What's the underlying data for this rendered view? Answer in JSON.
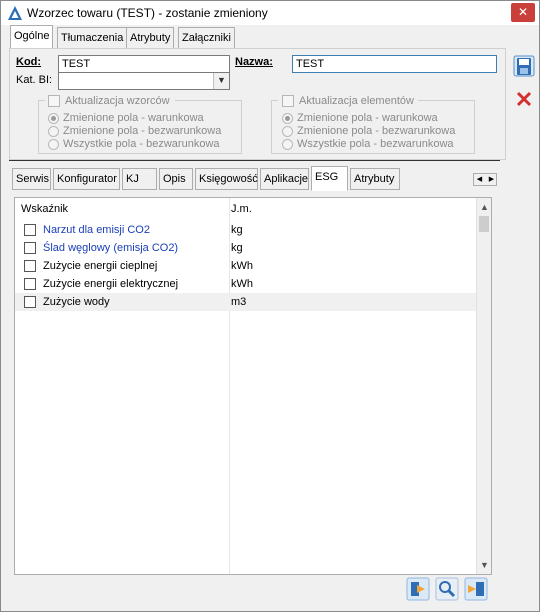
{
  "window": {
    "title": "Wzorzec towaru (TEST) - zostanie zmieniony"
  },
  "tabs_top": [
    "Ogólne",
    "Tłumaczenia",
    "Atrybuty",
    "Załączniki"
  ],
  "form": {
    "kod_label": "Kod:",
    "kod_value": "TEST",
    "nazwa_label": "Nazwa:",
    "nazwa_value": "TEST",
    "katbi_label": "Kat. BI:",
    "katbi_value": ""
  },
  "group_wzorcow": {
    "title": "Aktualizacja wzorców",
    "options": [
      "Zmienione pola - warunkowa",
      "Zmienione pola - bezwarunkowa",
      "Wszystkie pola - bezwarunkowa"
    ]
  },
  "group_elementow": {
    "title": "Aktualizacja elementów",
    "options": [
      "Zmienione pola - warunkowa",
      "Zmienione pola - bezwarunkowa",
      "Wszystkie pola - bezwarunkowa"
    ]
  },
  "tabs_bottom": [
    "Serwis",
    "Konfigurator",
    "KJ",
    "Opis",
    "Księgowość",
    "Aplikacje",
    "ESG",
    "Atrybuty"
  ],
  "grid": {
    "headers": [
      "Wskaźnik",
      "J.m."
    ],
    "rows": [
      {
        "name": "Narzut dla emisji CO2",
        "unit": "kg"
      },
      {
        "name": "Ślad węglowy (emisja CO2)",
        "unit": "kg"
      },
      {
        "name": "Zużycie energii cieplnej",
        "unit": "kWh"
      },
      {
        "name": "Zużycie energii elektrycznej",
        "unit": "kWh"
      },
      {
        "name": "Zużycie wody",
        "unit": "m3"
      }
    ]
  },
  "icons": {
    "app": "triangle-logo-icon",
    "save": "save-icon",
    "cancel": "cancel-x-icon",
    "bottom": [
      "export-icon",
      "search-icon",
      "import-icon"
    ]
  },
  "colors": {
    "accent": "#3c7fb1",
    "link": "#1a3fb8",
    "close": "#c9403a"
  }
}
